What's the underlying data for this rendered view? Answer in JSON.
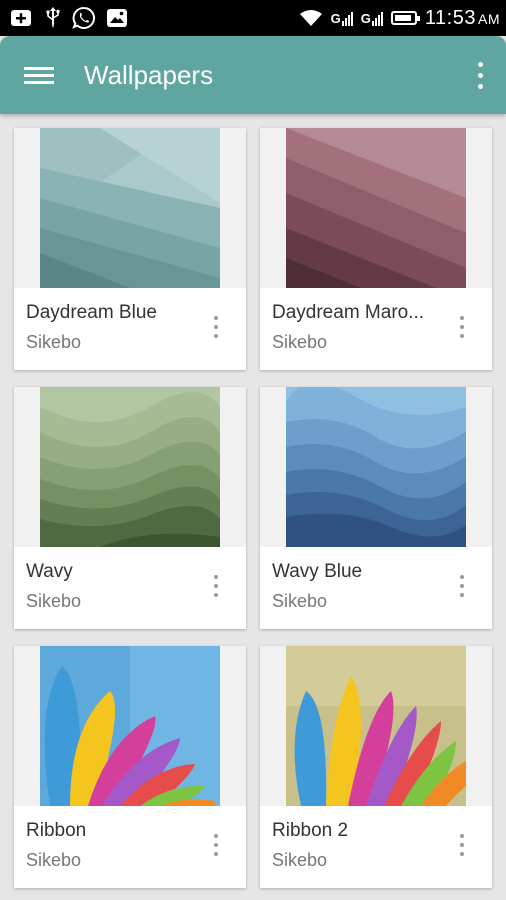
{
  "status_bar": {
    "time": "11:53",
    "ampm": "AM",
    "network_1": "G",
    "network_2": "G",
    "icons": [
      "add-notification-icon",
      "usb-icon",
      "whatsapp-icon",
      "image-icon",
      "wifi-icon",
      "signal-icon",
      "battery-icon"
    ]
  },
  "app_bar": {
    "title": "Wallpapers",
    "color": "#5fa5a0"
  },
  "wallpapers": [
    {
      "title": "Daydream Blue",
      "author": "Sikebo"
    },
    {
      "title": "Daydream Maro...",
      "author": "Sikebo"
    },
    {
      "title": "Wavy",
      "author": "Sikebo"
    },
    {
      "title": "Wavy Blue",
      "author": "Sikebo"
    },
    {
      "title": "Ribbon",
      "author": "Sikebo"
    },
    {
      "title": "Ribbon 2",
      "author": "Sikebo"
    }
  ]
}
